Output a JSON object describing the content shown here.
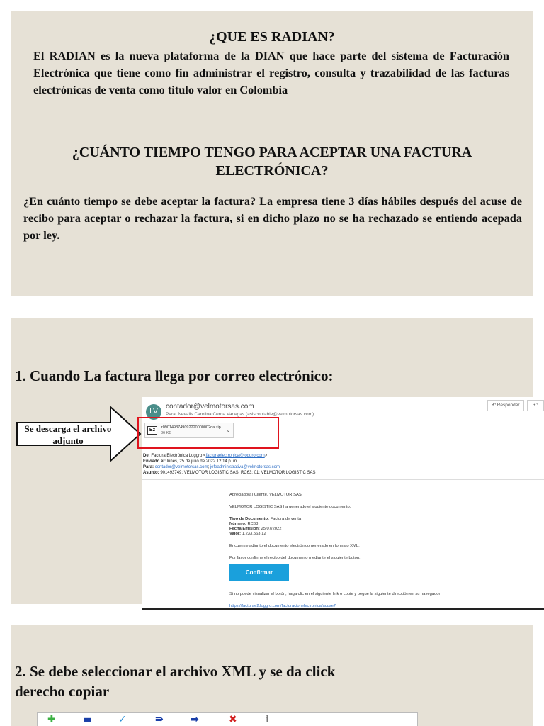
{
  "section1": {
    "title": "¿QUE ES RADIAN?",
    "body": "El RADIAN es la nueva plataforma de la DIAN que hace parte del sistema de Facturación Electrónica que tiene como fin administrar el registro, consulta y trazabilidad de las facturas electrónicas de venta como titulo valor en Colombia",
    "title2": "¿CUÁNTO TIEMPO TENGO PARA ACEPTAR UNA FACTURA ELECTRÓNICA?",
    "body2": "¿En cuánto tiempo se debe aceptar la factura? La empresa tiene 3 días hábiles después del acuse de recibo para aceptar o rechazar la factura, si en dicho plazo no se ha rechazado se entiendo acepada por ley."
  },
  "step1": {
    "title": "1. Cuando La factura llega por correo electrónico:",
    "callout": "Se descarga el archivo adjunto"
  },
  "email": {
    "avatar": "LV",
    "sender": "contador@velmotorsas.com",
    "to": "Para: Nevalis Carolina Cerna Vanegas (asiscontable@velmotorsas.com)",
    "reply": "Responder",
    "attachment": {
      "icon": "Ez",
      "name": "z0901493749092220000002da.zip",
      "size": "36 KB"
    },
    "headers": {
      "de_label": "De:",
      "de_value": "Factura Electrónica Loggro <",
      "de_link": "facturaelectronica@loggro.com",
      "de_close": ">",
      "enviado_label": "Enviado el:",
      "enviado_value": "lunes, 25 de julio de 2022 12:14 p. m.",
      "para_label": "Para:",
      "para_link1": "contador@velmotorsas.com",
      "para_sep": "; ",
      "para_link2": "jefeadministrativa@velmotorsas.com",
      "asunto_label": "Asunto:",
      "asunto_value": "901493749; VELMOTOR LOGISTIC SAS; RC63; 01; VELMOTOR LOGISTIC SAS"
    },
    "body": {
      "greeting": "Apreciado(a) Cliente, VELMOTOR SAS",
      "generated": "VELMOTOR LOGISTIC SAS ha generado el siguiente documento.",
      "tipo_label": "Tipo de Documento:",
      "tipo_value": "Factura de venta",
      "numero_label": "Número:",
      "numero_value": "RC63",
      "fecha_label": "Fecha Emisión:",
      "fecha_value": "25/07/2022",
      "valor_label": "Valor:",
      "valor_value": "1.233.563,12",
      "adjunto": "Encuentre adjunto el documento electrónico generado en formato XML.",
      "confirme": "Por favor confirme el recibo del documento mediante el siguiente botón:",
      "confirm_button": "Confirmar",
      "no_visual": "Si no puede visualizar el botón, haga clic en el siguiente link o copie y pegue la siguiente dirección en su navegador:",
      "url": "https://facturae2.loggro.com/facturacionelectronica/acuse?"
    }
  },
  "step2": {
    "title": "2. Se debe seleccionar el archivo XML y se da click derecho copiar"
  },
  "toolbar": {
    "icons": [
      "add-icon",
      "minus-icon",
      "check-icon",
      "move-icon",
      "arrow-right-icon",
      "delete-icon",
      "info-icon"
    ],
    "colors": {
      "add": "#3cb043",
      "minus": "#1a3fa8",
      "check": "#2a8fd6",
      "move": "#1a3fa8",
      "arrow": "#1a3fa8",
      "delete": "#d21f1f",
      "info": "#777777"
    }
  }
}
